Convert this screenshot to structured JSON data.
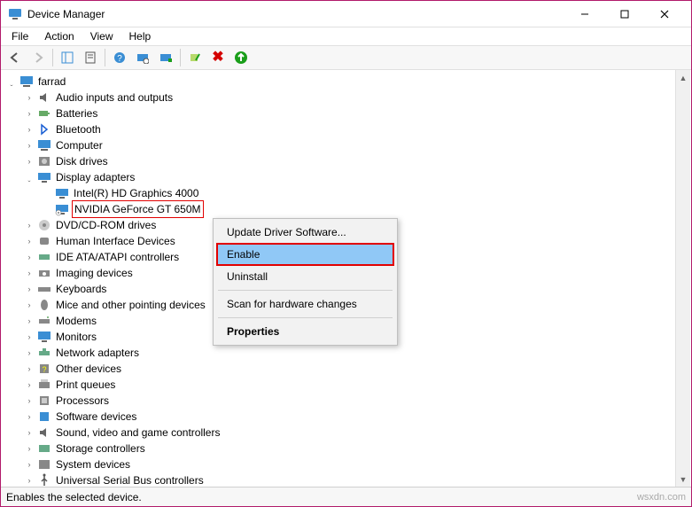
{
  "titlebar": {
    "title": "Device Manager"
  },
  "menubar": {
    "items": [
      "File",
      "Action",
      "View",
      "Help"
    ]
  },
  "status": {
    "text": "Enables the selected device."
  },
  "watermark": "wsxdn.com",
  "tree": {
    "root": "farrad",
    "nodes": [
      {
        "label": "Audio inputs and outputs"
      },
      {
        "label": "Batteries"
      },
      {
        "label": "Bluetooth"
      },
      {
        "label": "Computer"
      },
      {
        "label": "Disk drives"
      },
      {
        "label": "Display adapters",
        "children": [
          {
            "label": "Intel(R) HD Graphics 4000"
          },
          {
            "label": "NVIDIA GeForce GT 650M"
          }
        ]
      },
      {
        "label": "DVD/CD-ROM drives"
      },
      {
        "label": "Human Interface Devices"
      },
      {
        "label": "IDE ATA/ATAPI controllers"
      },
      {
        "label": "Imaging devices"
      },
      {
        "label": "Keyboards"
      },
      {
        "label": "Mice and other pointing devices"
      },
      {
        "label": "Modems"
      },
      {
        "label": "Monitors"
      },
      {
        "label": "Network adapters"
      },
      {
        "label": "Other devices"
      },
      {
        "label": "Print queues"
      },
      {
        "label": "Processors"
      },
      {
        "label": "Software devices"
      },
      {
        "label": "Sound, video and game controllers"
      },
      {
        "label": "Storage controllers"
      },
      {
        "label": "System devices"
      },
      {
        "label": "Universal Serial Bus controllers"
      }
    ]
  },
  "context_menu": {
    "items": [
      {
        "label": "Update Driver Software..."
      },
      {
        "label": "Enable",
        "highlight": true
      },
      {
        "label": "Uninstall"
      },
      {
        "sep": true
      },
      {
        "label": "Scan for hardware changes"
      },
      {
        "sep": true
      },
      {
        "label": "Properties",
        "bold": true
      }
    ]
  }
}
